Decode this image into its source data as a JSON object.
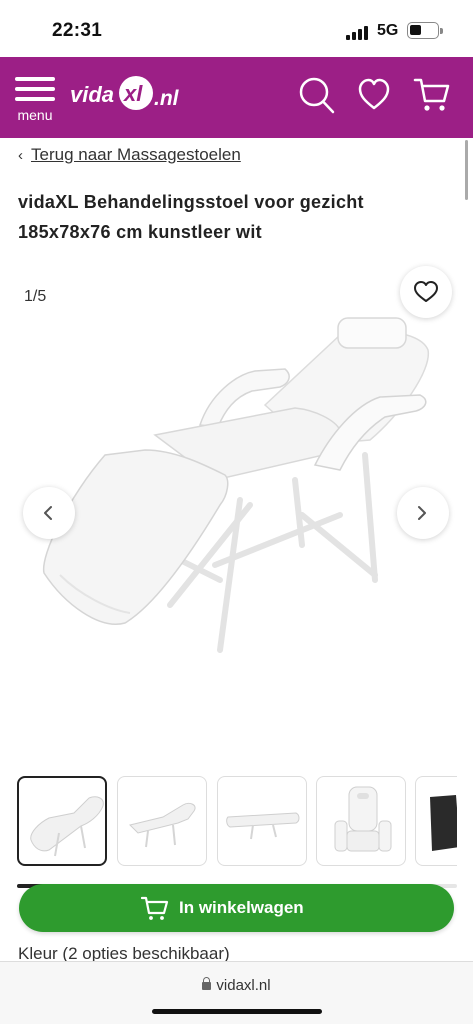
{
  "status_bar": {
    "time": "22:31",
    "network": "5G"
  },
  "header": {
    "menu_label": "menu",
    "logo_text": "vidaXL.nl",
    "brand_color": "#9c1f86",
    "icons": [
      "search-icon",
      "heart-icon",
      "cart-icon"
    ]
  },
  "breadcrumb": {
    "label": "Terug naar Massagestoelen"
  },
  "product": {
    "title": "vidaXL Behandelingsstoel voor gezicht 185x78x76 cm kunstleer wit"
  },
  "gallery": {
    "counter": "1/5",
    "thumbnail_count": 5,
    "active_index": 0,
    "scroll_progress": 0.23
  },
  "actions": {
    "add_to_cart_label": "In winkelwagen",
    "cart_button_color": "#2e9b2e"
  },
  "options": {
    "color_label": "Kleur (2 opties beschikbaar)"
  },
  "browser": {
    "url": "vidaxl.nl"
  }
}
